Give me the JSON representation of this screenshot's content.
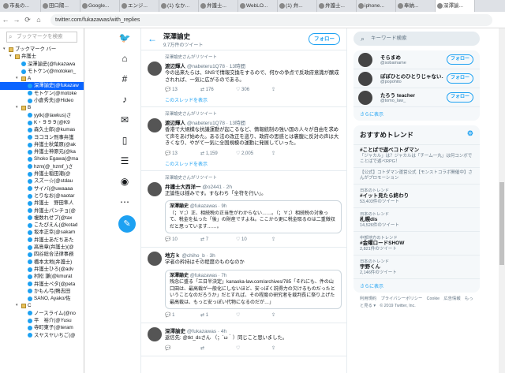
{
  "browser": {
    "tabs": [
      "市長の...",
      "田口陽...",
      "Google...",
      "エンジ...",
      "(1) なか...",
      "弁護士...",
      "WebLO...",
      "(1) 弁...",
      "弁護士...",
      "iphone...",
      "奉納...",
      "深澤諭..."
    ],
    "active_tab": 11,
    "url": "twitter.com/fukazawas/with_replies"
  },
  "bookmarks": {
    "search_placeholder": "ブックマークを検索",
    "items": [
      {
        "label": "ブックマーク バー",
        "type": "folder",
        "indent": 0,
        "exp": "▾"
      },
      {
        "label": "弁護士",
        "type": "folder",
        "indent": 1,
        "exp": "▾"
      },
      {
        "label": "深澤諭史(@fukazawa",
        "type": "bird",
        "indent": 2
      },
      {
        "label": "モトケン(@motoken_",
        "type": "bird",
        "indent": 2
      },
      {
        "label": "A",
        "type": "folder",
        "indent": 2,
        "exp": "▾"
      },
      {
        "label": "深澤諭史(@fukazaw",
        "type": "bird",
        "indent": 3,
        "selected": true
      },
      {
        "label": "モトケン(@motoke",
        "type": "bird",
        "indent": 3
      },
      {
        "label": "小倉秀夫(@Hideo",
        "type": "bird",
        "indent": 3
      },
      {
        "label": "B",
        "type": "folder",
        "indent": 2,
        "exp": "▾"
      },
      {
        "label": "yytk(@lawkus)さ",
        "type": "bird",
        "indent": 3
      },
      {
        "label": "K・９９９(@K9",
        "type": "bird",
        "indent": 3
      },
      {
        "label": "森久士郎(@kumas",
        "type": "bird",
        "indent": 3
      },
      {
        "label": "ヨコヨン刑事弁護",
        "type": "bird",
        "indent": 3
      },
      {
        "label": "弁護士秋葉原(@ak",
        "type": "bird",
        "indent": 3
      },
      {
        "label": "弁護士神原元(@ka",
        "type": "bird",
        "indent": 3
      },
      {
        "label": "Shoko Egawa(@ma",
        "type": "bird",
        "indent": 3
      },
      {
        "label": "hzm(@_hzmf_)さ",
        "type": "bird",
        "indent": 3
      },
      {
        "label": "弁護士稲田潮(@",
        "type": "bird",
        "indent": 3
      },
      {
        "label": "スズー☆(@stdau",
        "type": "bird",
        "indent": 3
      },
      {
        "label": "サイバ(@uwaaaa",
        "type": "bird",
        "indent": 3
      },
      {
        "label": "とりなお(@naotar",
        "type": "bird",
        "indent": 3
      },
      {
        "label": "弁護士　野田隼人",
        "type": "bird",
        "indent": 3
      },
      {
        "label": "弁護士パンチョ(@",
        "type": "bird",
        "indent": 3
      },
      {
        "label": "複数れせプ(@tax",
        "type": "bird",
        "indent": 3
      },
      {
        "label": "こたぴえん(@kotad",
        "type": "bird",
        "indent": 3
      },
      {
        "label": "坂本正幸(@sakam",
        "type": "bird",
        "indent": 3
      },
      {
        "label": "弁護士あだちあた",
        "type": "bird",
        "indent": 3
      },
      {
        "label": "高島章(弁護士)(@",
        "type": "bird",
        "indent": 3
      },
      {
        "label": "四谷総合法律事務",
        "type": "bird",
        "indent": 3
      },
      {
        "label": "橋本太地(弁護士)",
        "type": "bird",
        "indent": 3
      },
      {
        "label": "弁護士ひろ(@adv",
        "type": "bird",
        "indent": 3
      },
      {
        "label": "村松 謙(@kmurat",
        "type": "bird",
        "indent": 3
      },
      {
        "label": "弁護士ペタ(@peta",
        "type": "bird",
        "indent": 3
      },
      {
        "label": "かもん弓(鴨志田",
        "type": "bird",
        "indent": 3
      },
      {
        "label": "SANO, Ayako/佐",
        "type": "bird",
        "indent": 3
      },
      {
        "label": "C",
        "type": "folder",
        "indent": 2,
        "exp": "▾"
      },
      {
        "label": "ノースライム(@no",
        "type": "bird",
        "indent": 3
      },
      {
        "label": "平　裕介(@Yusu",
        "type": "bird",
        "indent": 3
      },
      {
        "label": "寺町東子(@teram",
        "type": "bird",
        "indent": 3
      },
      {
        "label": "スヤスヤいちご(@",
        "type": "bird",
        "indent": 3
      }
    ]
  },
  "profile": {
    "name": "深澤諭史",
    "tweet_count": "9.7万件のツイート",
    "follow_label": "フォロー"
  },
  "tweets": [
    {
      "retweet": "深澤諭史さんがリツイート",
      "name": "渡辺輝人",
      "handle": "@nabeteru1Q78 · 13時間",
      "text": "今の出来たらは、SNSで情報交換をするので、何かの争点で反政府意識が醸成されれば、一気に広がるのである。",
      "actions": [
        "",
        "13",
        "176",
        "306",
        ""
      ],
      "thread": "このスレッドを表示"
    },
    {
      "retweet": "深澤諭史さんがリツイート",
      "name": "渡辺輝人",
      "handle": "@nabeteru1Q78 · 13時間",
      "text": "香港で大規模な抗議運動が起こるなど、情報統制の強い国の人々が自由を求めて声をあげ始めた。ある法の改正を巡り、政府の思惑とは裏腹に反対の声は大きくなり、やがて一気に全国規模の運動に発展していった。",
      "actions": [
        "",
        "13",
        "1,159",
        "2,005",
        ""
      ],
      "thread": "このスレッドを表示"
    },
    {
      "retweet": "深澤諭史さんがリツイート",
      "name": "弁護士大西洋一",
      "handle": "@o2441 · 2h",
      "text": "正論性は揺みです。すなわち「全符を行い」。",
      "quote_name": "深澤諭史",
      "quote_handle": "@fukazawas · 9h",
      "quote_text": "（；∀；）正、相続税の正当性がわからない……。（；∀；）相続税の対象って、税金を払った「後」の財産ですよね。ここから更に税金取るのは二重徴収だと思っています……。",
      "actions": [
        "",
        "10",
        "7",
        "10",
        ""
      ]
    },
    {
      "retweet": "",
      "name": "地方ｋ",
      "handle": "@chiho_b · 3h",
      "text": "学者の矜持はその程度のものなのか",
      "quote_name": "深澤諭史",
      "quote_handle": "@fukazawas · 7h",
      "quote_text": "残念に盛る「三日半決定」kanaoka-law.com/archives/785「それにも、件の山口田は、最高裁が一般化にしないほど、安っぽく説得力の欠けるものだったということなのだろうか」だとすれば、その程度の研究者を裁判長に祭り上げた最高裁は、もっと安っぽい代物になるのだが…」",
      "actions": [
        "",
        "1",
        "1",
        "",
        ""
      ]
    },
    {
      "retweet": "",
      "name": "深澤諭史",
      "handle": "@fukazawas · 4h",
      "text": "返信先: @tkt_dsさん\n（；´ω｀）同じこと思いました。",
      "actions": [
        "",
        "",
        "",
        "",
        ""
      ]
    }
  ],
  "right": {
    "search_placeholder": "キーワード検索",
    "recommend": [
      {
        "name": "そらまめ",
        "handle": "@sobamame",
        "follow": "フォロー"
      },
      {
        "name": "ぽぽひとのひとりじゃない...",
        "handle": "@popohito",
        "follow": "フォロー"
      },
      {
        "name": "たろう teacher",
        "handle": "@tomo_law_",
        "follow": "フォロー"
      }
    ],
    "more": "さらに表示",
    "trends_title": "おすすめトレンド",
    "trends": [
      {
        "cat": "",
        "title": "#ことばで遊べコトダマン",
        "desc": "「ジャカル」は？ジャカルは「チーム一丸」は何コンボでことばで遊べRPG！"
      },
      {
        "cat": "",
        "title": "",
        "desc": "【公式】コトダマン運営公式【モンストコラボ開催中】さんがプロモーション"
      },
      {
        "cat": "日本のトレンド",
        "title": "#イット見たら終わり",
        "desc": "53,403件のツイート"
      },
      {
        "cat": "日本のトレンド",
        "title": "札幌dis",
        "desc": "14,526件のツイート"
      },
      {
        "cat": "中部地方のトレンド",
        "title": "#金曜ロードSHOW",
        "desc": "2,821件のツイート"
      },
      {
        "cat": "日本のトレンド",
        "title": "宇野くん",
        "desc": "2,146件のツイート"
      }
    ],
    "trends_more": "さらに表示",
    "footer": "利用規約　プライバシーポリシー　Cookie　広告情報　もっと見る ▾　© 2019 Twitter, Inc."
  }
}
